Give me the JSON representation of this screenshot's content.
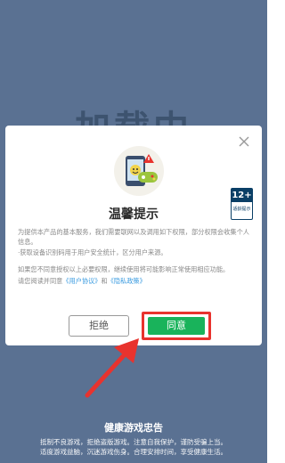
{
  "background": {
    "color": "#5a7192",
    "loading_text": "加载中"
  },
  "dialog": {
    "title": "温馨提示",
    "age_rating": {
      "number": "12+",
      "caption": "适龄提示"
    },
    "paragraphs": [
      "为提供本产品的基本服务，我们需要联网以及调用如下权限，部分权限会收集个人信息。",
      "·获取设备识别码用于用户安全统计，区分用户来源。",
      "如果您不同意授权以上必要权限，继续使用将可能影响正常使用相应功能。"
    ],
    "agreement_prefix": "请您阅读并同意",
    "user_agreement_link": "《用户协议》",
    "agreement_and": "和",
    "privacy_policy_link": "《隐私政策》",
    "refuse_label": "拒绝",
    "agree_label": "同意"
  },
  "notice": {
    "title": "健康游戏忠告",
    "lines": [
      "抵制不良游戏，拒绝盗版游戏。注意自我保护，谨防受骗上当。",
      "适度游戏益脑，沉迷游戏伤身。合理安排时间，享受健康生活。"
    ]
  },
  "colors": {
    "agree": "#19b35b",
    "highlight": "#e8332e",
    "link": "#3a9be0"
  }
}
